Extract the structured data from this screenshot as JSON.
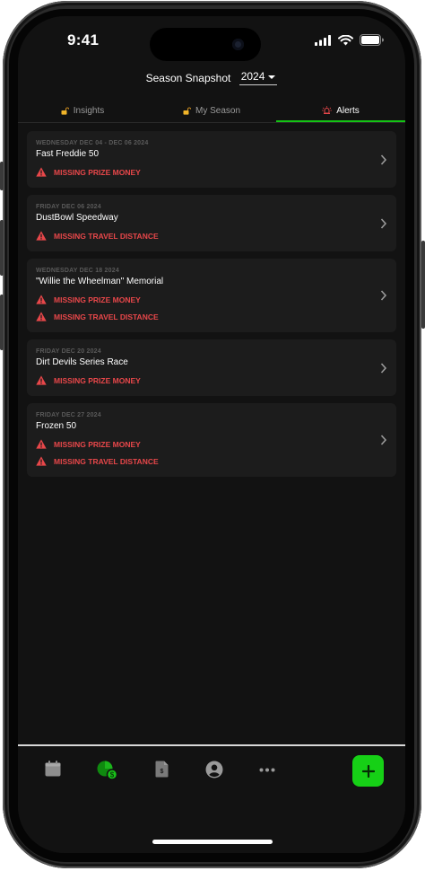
{
  "status": {
    "time": "9:41"
  },
  "header": {
    "label": "Season Snapshot",
    "year": "2024"
  },
  "tabs": [
    {
      "label": "Insights",
      "icon": "lock-icon",
      "active": false
    },
    {
      "label": "My Season",
      "icon": "lock-icon",
      "active": false
    },
    {
      "label": "Alerts",
      "icon": "alert-bell-icon",
      "active": true
    }
  ],
  "alerts": [
    {
      "date": "WEDNESDAY DEC 04 - DEC 06 2024",
      "title": "Fast Freddie 50",
      "issues": [
        "MISSING PRIZE MONEY"
      ]
    },
    {
      "date": "FRIDAY DEC 06 2024",
      "title": "DustBowl Speedway",
      "issues": [
        "MISSING TRAVEL DISTANCE"
      ]
    },
    {
      "date": "WEDNESDAY DEC 18 2024",
      "title": "\"Willie the Wheelman\" Memorial",
      "issues": [
        "MISSING PRIZE MONEY",
        "MISSING TRAVEL DISTANCE"
      ]
    },
    {
      "date": "FRIDAY DEC 20 2024",
      "title": "Dirt Devils Series Race",
      "issues": [
        "MISSING PRIZE MONEY"
      ]
    },
    {
      "date": "FRIDAY DEC 27 2024",
      "title": "Frozen 50",
      "issues": [
        "MISSING PRIZE MONEY",
        "MISSING TRAVEL DISTANCE"
      ]
    }
  ],
  "colors": {
    "accent": "#14c414",
    "alert": "#e8474a",
    "card": "#1c1c1c",
    "background": "#121212"
  },
  "tabbar": {
    "items": [
      "calendar-icon",
      "season-chart-icon",
      "receipt-icon",
      "profile-icon",
      "more-icon"
    ],
    "fab": "add-icon"
  }
}
